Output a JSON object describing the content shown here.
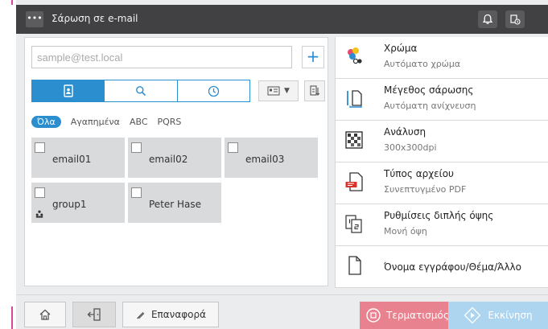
{
  "header": {
    "title": "Σάρωση σε e-mail",
    "menu_glyph": "•••",
    "notification_icon": "bell-icon",
    "job_icon": "job-status-icon"
  },
  "address_entry": {
    "placeholder": "sample@test.local",
    "add_label": "+"
  },
  "tabs": [
    {
      "name": "address-book",
      "icon": "address-book-icon",
      "active": true
    },
    {
      "name": "search",
      "icon": "search-icon",
      "active": false
    },
    {
      "name": "history",
      "icon": "clock-icon",
      "active": false
    }
  ],
  "filters": [
    "Όλα",
    "Αγαπημένα",
    "ABC",
    "PQRS"
  ],
  "addresses": [
    {
      "label": "email01",
      "group": false
    },
    {
      "label": "email02",
      "group": false
    },
    {
      "label": "email03",
      "group": false
    },
    {
      "label": "group1",
      "group": true
    },
    {
      "label": "Peter Hase",
      "group": false
    }
  ],
  "settings": [
    {
      "title": "Χρώμα",
      "value": "Αυτόματο χρώμα",
      "icon": "color-icon"
    },
    {
      "title": "Μέγεθος σάρωσης",
      "value": "Αυτόματη ανίχνευση",
      "icon": "scan-size-icon"
    },
    {
      "title": "Ανάλυση",
      "value": "300x300dpi",
      "icon": "resolution-icon"
    },
    {
      "title": "Τύπος αρχείου",
      "value": "Συνεπτυγμένο PDF",
      "icon": "pdf-file-icon"
    },
    {
      "title": "Ρυθμίσεις διπλής όψης",
      "value": "Μονή όψη",
      "icon": "duplex-icon"
    },
    {
      "title": "Όνομα εγγράφου/Θέμα/Άλλο",
      "value": "",
      "icon": "document-name-icon"
    }
  ],
  "bottom": {
    "reset_label": "Επαναφορά",
    "stop_label": "Τερματισμός",
    "start_label": "Εκκίνηση"
  },
  "colors": {
    "accent": "#2a8ecf",
    "topbar": "#414143",
    "stop": "#e9828f",
    "start": "#aed5ef"
  }
}
